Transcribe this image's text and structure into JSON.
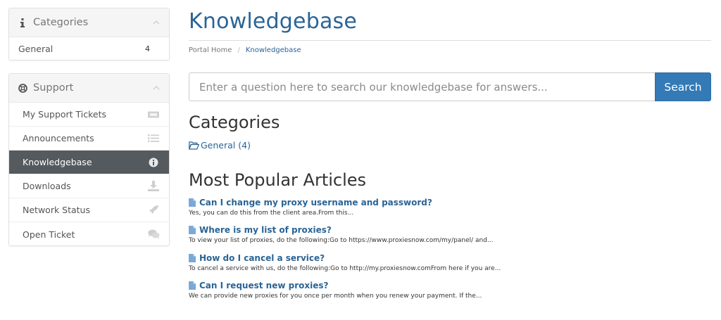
{
  "sidebar": {
    "categories_panel": {
      "title": "Categories",
      "items": [
        {
          "label": "General",
          "count": "4"
        }
      ]
    },
    "support_panel": {
      "title": "Support",
      "items": [
        {
          "label": "My Support Tickets",
          "icon": "ticket-icon"
        },
        {
          "label": "Announcements",
          "icon": "list-icon"
        },
        {
          "label": "Knowledgebase",
          "icon": "info-circle-icon",
          "active": true
        },
        {
          "label": "Downloads",
          "icon": "download-icon"
        },
        {
          "label": "Network Status",
          "icon": "rocket-icon"
        },
        {
          "label": "Open Ticket",
          "icon": "comments-icon"
        }
      ]
    }
  },
  "main": {
    "title": "Knowledgebase",
    "breadcrumb": [
      "Portal Home",
      "/",
      "Knowledgebase"
    ],
    "search": {
      "placeholder": "Enter a question here to search our knowledgebase for answers...",
      "button_label": "Search"
    },
    "categories_heading": "Categories",
    "category_link": "General (4)",
    "popular_heading": "Most Popular Articles",
    "articles": [
      {
        "title": "Can I change my proxy username and password?",
        "snippet": "Yes, you can do this from the client area.From this..."
      },
      {
        "title": "Where is my list of proxies?",
        "snippet": "To view your list of proxies, do the following:Go to https://www.proxiesnow.com/my/panel/ and..."
      },
      {
        "title": "How do I cancel a service?",
        "snippet": "To cancel a service with us, do the following:Go to http://my.proxiesnow.comFrom here if you are..."
      },
      {
        "title": "Can I request new proxies?",
        "snippet": "We can provide new proxies for you once per month when you renew your payment.  If the..."
      }
    ]
  },
  "colors": {
    "link": "#2a6496",
    "button": "#337ab7",
    "active_item_bg": "#555a5e"
  }
}
